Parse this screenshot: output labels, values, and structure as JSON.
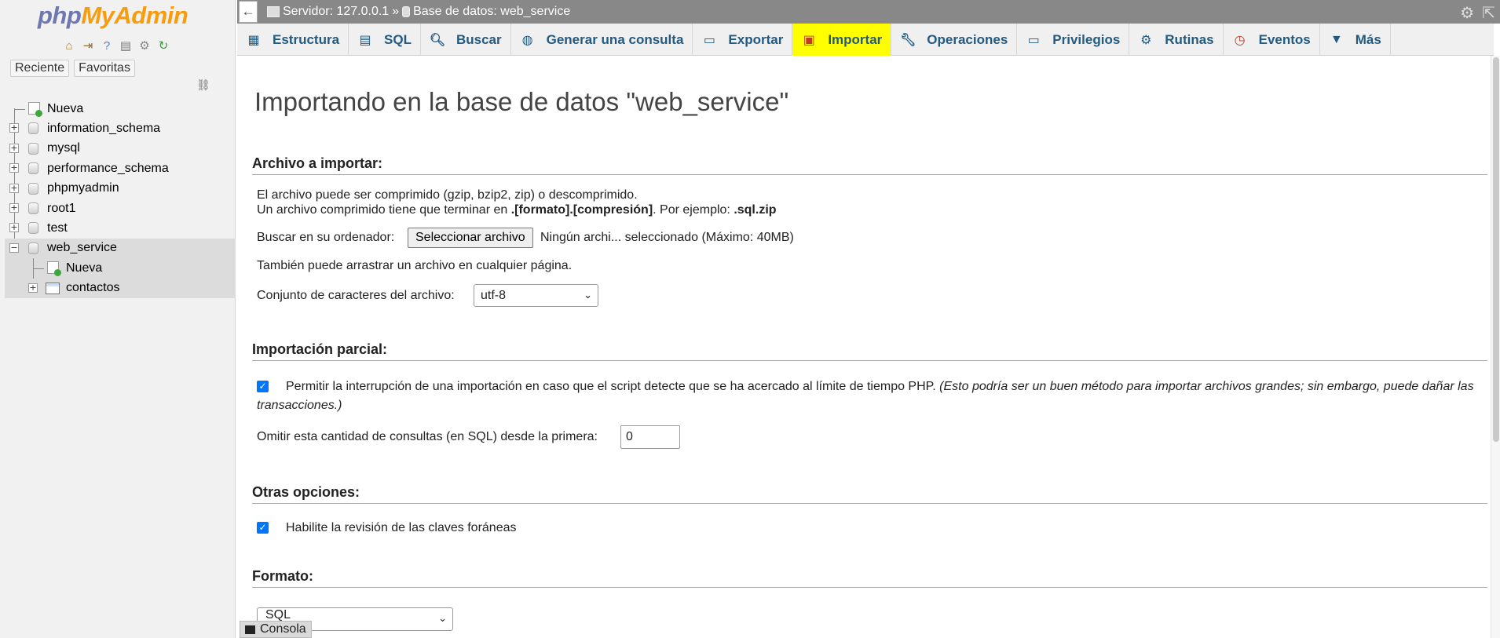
{
  "sidebar": {
    "logo": {
      "part1": "php",
      "part2": "MyAdmin"
    },
    "quick_icons": [
      "home-icon",
      "logout-icon",
      "help-icon",
      "docs-icon",
      "settings-icon",
      "reload-icon"
    ],
    "recent_label": "Reciente",
    "favorites_label": "Favoritas",
    "tree": {
      "new": "Nueva",
      "dbs": [
        "information_schema",
        "mysql",
        "performance_schema",
        "phpmyadmin",
        "root1",
        "test"
      ],
      "selected_db": "web_service",
      "selected_new": "Nueva",
      "selected_table": "contactos"
    }
  },
  "topbar": {
    "server": "Servidor: 127.0.0.1",
    "separator": "»",
    "database": "Base de datos: web_service"
  },
  "tabs": [
    {
      "label": "Estructura",
      "icon": "structure-icon"
    },
    {
      "label": "SQL",
      "icon": "sql-icon"
    },
    {
      "label": "Buscar",
      "icon": "search-icon"
    },
    {
      "label": "Generar una consulta",
      "icon": "query-icon"
    },
    {
      "label": "Exportar",
      "icon": "export-icon"
    },
    {
      "label": "Importar",
      "icon": "import-icon",
      "active": true
    },
    {
      "label": "Operaciones",
      "icon": "wrench-icon"
    },
    {
      "label": "Privilegios",
      "icon": "privileges-icon"
    },
    {
      "label": "Rutinas",
      "icon": "routines-icon"
    },
    {
      "label": "Eventos",
      "icon": "clock-icon"
    },
    {
      "label": "Más",
      "icon": "caret-down-icon"
    }
  ],
  "main": {
    "title": "Importando en la base de datos \"web_service\"",
    "file_section": {
      "heading": "Archivo a importar:",
      "line1": "El archivo puede ser comprimido (gzip, bzip2, zip) o descomprimido.",
      "line2_pre": "Un archivo comprimido tiene que terminar en ",
      "line2_bold": ".[formato].[compresión]",
      "line2_mid": ". Por ejemplo: ",
      "line2_example": ".sql.zip",
      "browse_label": "Buscar en su ordenador:",
      "browse_button": "Seleccionar archivo",
      "no_file": "Ningún archi... seleccionado",
      "max_size": "(Máximo: 40MB)",
      "drag_hint": "También puede arrastrar un archivo en cualquier página.",
      "charset_label": "Conjunto de caracteres del archivo:",
      "charset_value": "utf-8"
    },
    "partial_section": {
      "heading": "Importación parcial:",
      "interrupt_label": "Permitir la interrupción de una importación en caso que el script detecte que se ha acercado al límite de tiempo PHP.",
      "interrupt_note": "(Esto podría ser un buen método para importar archivos grandes; sin embargo, puede dañar las transacciones.)",
      "interrupt_checked": true,
      "skip_label": "Omitir esta cantidad de consultas (en SQL) desde la primera:",
      "skip_value": "0"
    },
    "other_section": {
      "heading": "Otras opciones:",
      "fk_label": "Habilite la revisión de las claves foráneas",
      "fk_checked": true
    },
    "format_section": {
      "heading": "Formato:",
      "format_value": "SQL"
    }
  },
  "console": {
    "label": "Consola"
  }
}
